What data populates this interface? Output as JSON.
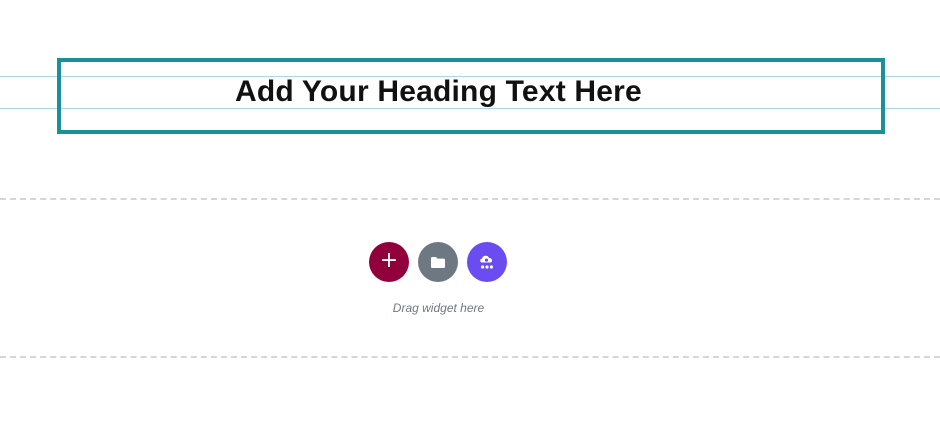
{
  "heading": {
    "text": "Add Your Heading Text Here",
    "border_color": "#1a9199"
  },
  "dropzone": {
    "buttons": [
      {
        "name": "add-section",
        "icon": "plus-icon",
        "color": "#92003b",
        "glyph": "+"
      },
      {
        "name": "add-template",
        "icon": "folder-icon",
        "color": "#6d7882"
      },
      {
        "name": "ai-builder",
        "icon": "ai-cloud-icon",
        "color": "#6b4cf0"
      }
    ],
    "hint": "Drag widget here"
  }
}
